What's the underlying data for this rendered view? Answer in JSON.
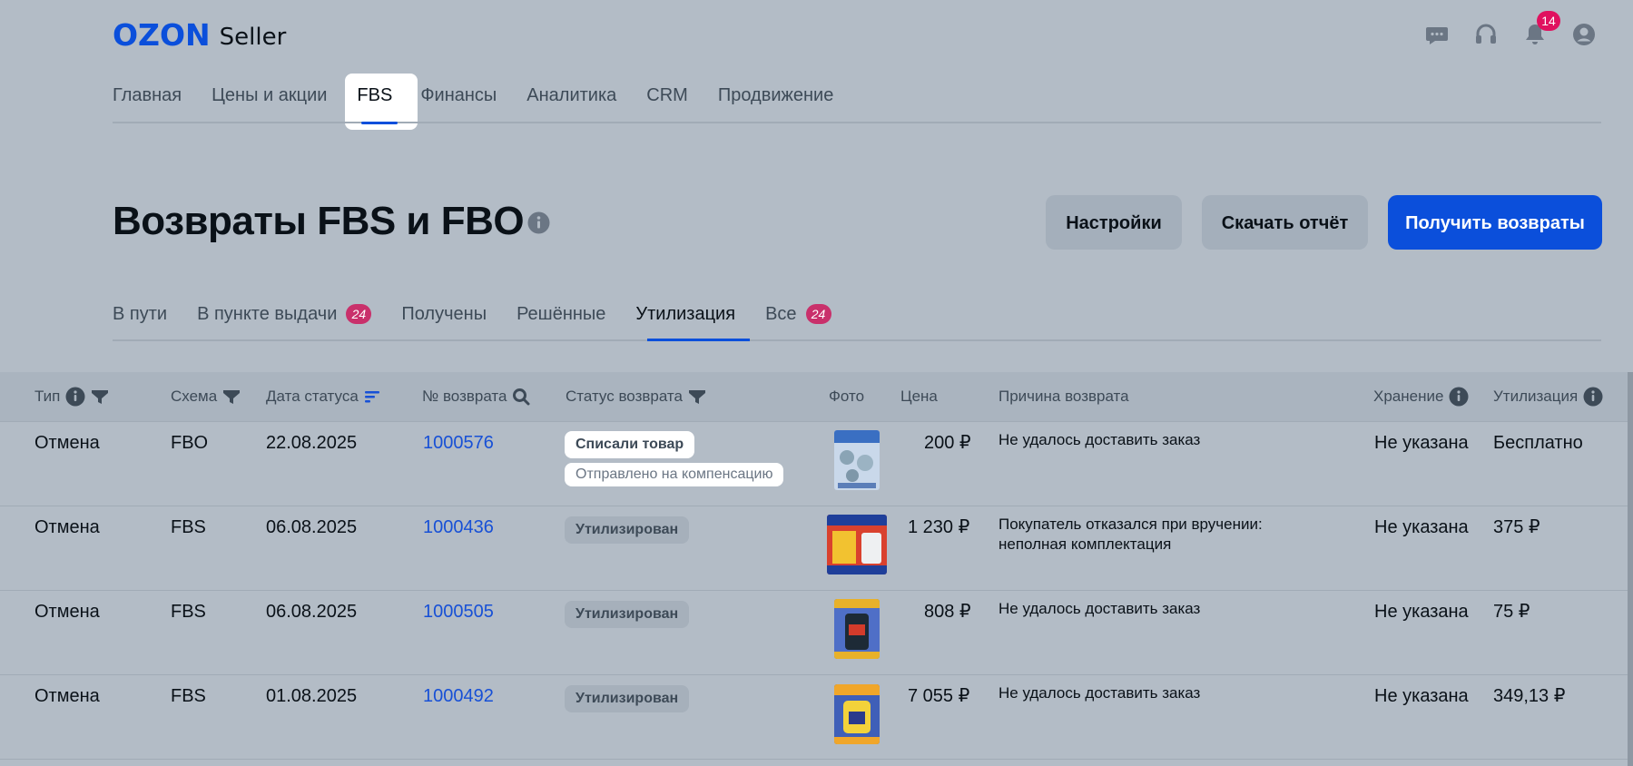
{
  "header": {
    "logo_ozon": "OZON",
    "logo_seller": "Seller",
    "notification_count": "14",
    "icons": [
      "chat-icon",
      "headset-icon",
      "bell-icon",
      "user-icon"
    ]
  },
  "top_nav": [
    {
      "label": "Главная"
    },
    {
      "label": "Цены и акции"
    },
    {
      "label": "FBS"
    },
    {
      "label": "Финансы"
    },
    {
      "label": "Аналитика"
    },
    {
      "label": "CRM"
    },
    {
      "label": "Продвижение"
    }
  ],
  "page": {
    "title": "Возвраты FBS и FBO",
    "buttons": {
      "settings": "Настройки",
      "download": "Скачать отчёт",
      "get_returns": "Получить возвраты"
    }
  },
  "sub_tabs": [
    {
      "label": "В пути",
      "badge": ""
    },
    {
      "label": "В пункте выдачи",
      "badge": "24"
    },
    {
      "label": "Получены",
      "badge": ""
    },
    {
      "label": "Решённые",
      "badge": ""
    },
    {
      "label": "Утилизация",
      "badge": ""
    },
    {
      "label": "Все",
      "badge": "24"
    }
  ],
  "table": {
    "columns": {
      "type": "Тип",
      "scheme": "Схема",
      "status_date": "Дата статуса",
      "return_no": "№ возврата",
      "return_status": "Статус возврата",
      "photo": "Фото",
      "price": "Цена",
      "reason": "Причина возврата",
      "storage": "Хранение",
      "disposal": "Утилизация"
    },
    "rows": [
      {
        "type": "Отмена",
        "scheme": "FBO",
        "date": "22.08.2025",
        "return_no": "1000576",
        "status": "Списали товар",
        "status_sub": "Отправлено на компенсацию",
        "price": "200 ₽",
        "reason": "Не удалось доставить заказ",
        "reason2": "",
        "storage": "Не указана",
        "disposal": "Бесплатно"
      },
      {
        "type": "Отмена",
        "scheme": "FBS",
        "date": "06.08.2025",
        "return_no": "1000436",
        "status": "Утилизирован",
        "status_sub": "",
        "price": "1 230 ₽",
        "reason": "Покупатель отказался при вручении:",
        "reason2": "неполная комплектация",
        "storage": "Не указана",
        "disposal": "375 ₽"
      },
      {
        "type": "Отмена",
        "scheme": "FBS",
        "date": "06.08.2025",
        "return_no": "1000505",
        "status": "Утилизирован",
        "status_sub": "",
        "price": "808 ₽",
        "reason": "Не удалось доставить заказ",
        "reason2": "",
        "storage": "Не указана",
        "disposal": "75 ₽"
      },
      {
        "type": "Отмена",
        "scheme": "FBS",
        "date": "01.08.2025",
        "return_no": "1000492",
        "status": "Утилизирован",
        "status_sub": "",
        "price": "7 055 ₽",
        "reason": "Не удалось доставить заказ",
        "reason2": "",
        "storage": "Не указана",
        "disposal": "349,13 ₽"
      }
    ]
  },
  "colors": {
    "brand": "#0b4fdb",
    "badge": "#e0115f",
    "tab_badge": "#c9306b",
    "link": "#1750d6"
  }
}
